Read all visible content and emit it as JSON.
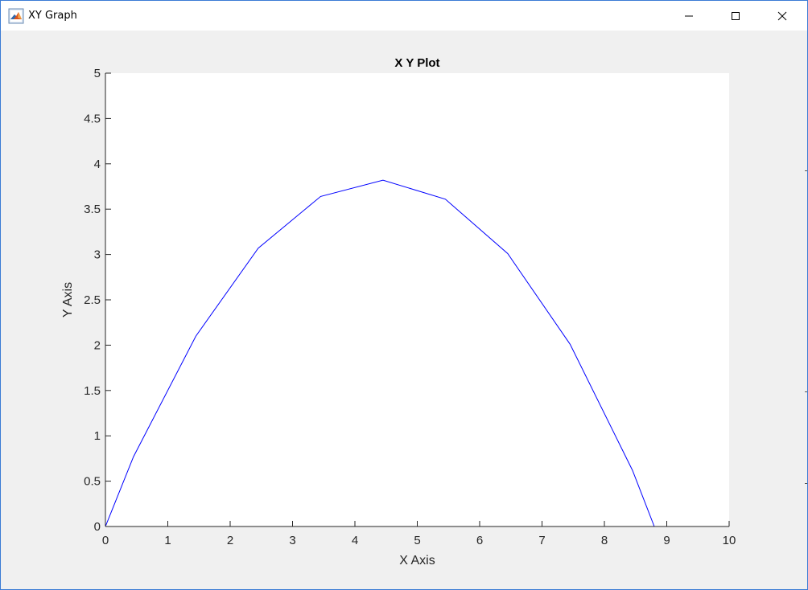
{
  "window": {
    "title": "XY Graph",
    "icon": "matlab-icon",
    "controls": {
      "minimize": "minimize-icon",
      "maximize": "maximize-icon",
      "close": "close-icon"
    }
  },
  "chart_data": {
    "type": "line",
    "title": "X Y Plot",
    "xlabel": "X Axis",
    "ylabel": "Y Axis",
    "xlim": [
      0,
      10
    ],
    "ylim": [
      0,
      5
    ],
    "xticks": [
      "0",
      "1",
      "2",
      "3",
      "4",
      "5",
      "6",
      "7",
      "8",
      "9",
      "10"
    ],
    "yticks": [
      "0",
      "0.5",
      "1",
      "1.5",
      "2",
      "2.5",
      "3",
      "3.5",
      "4",
      "4.5",
      "5"
    ],
    "grid": false,
    "legend": "none",
    "series": [
      {
        "color": "#0000ff",
        "x": [
          0,
          0.45,
          1.45,
          2.45,
          3.45,
          4.45,
          5.45,
          6.45,
          7.45,
          8.45,
          8.8
        ],
        "y": [
          0,
          0.77,
          2.1,
          3.07,
          3.64,
          3.82,
          3.61,
          3.01,
          2.01,
          0.62,
          0
        ]
      }
    ],
    "colors": {
      "axes_background": "#ffffff",
      "figure_background": "#f0f0f0",
      "axis": "#262626",
      "line": "#0000ff"
    }
  }
}
